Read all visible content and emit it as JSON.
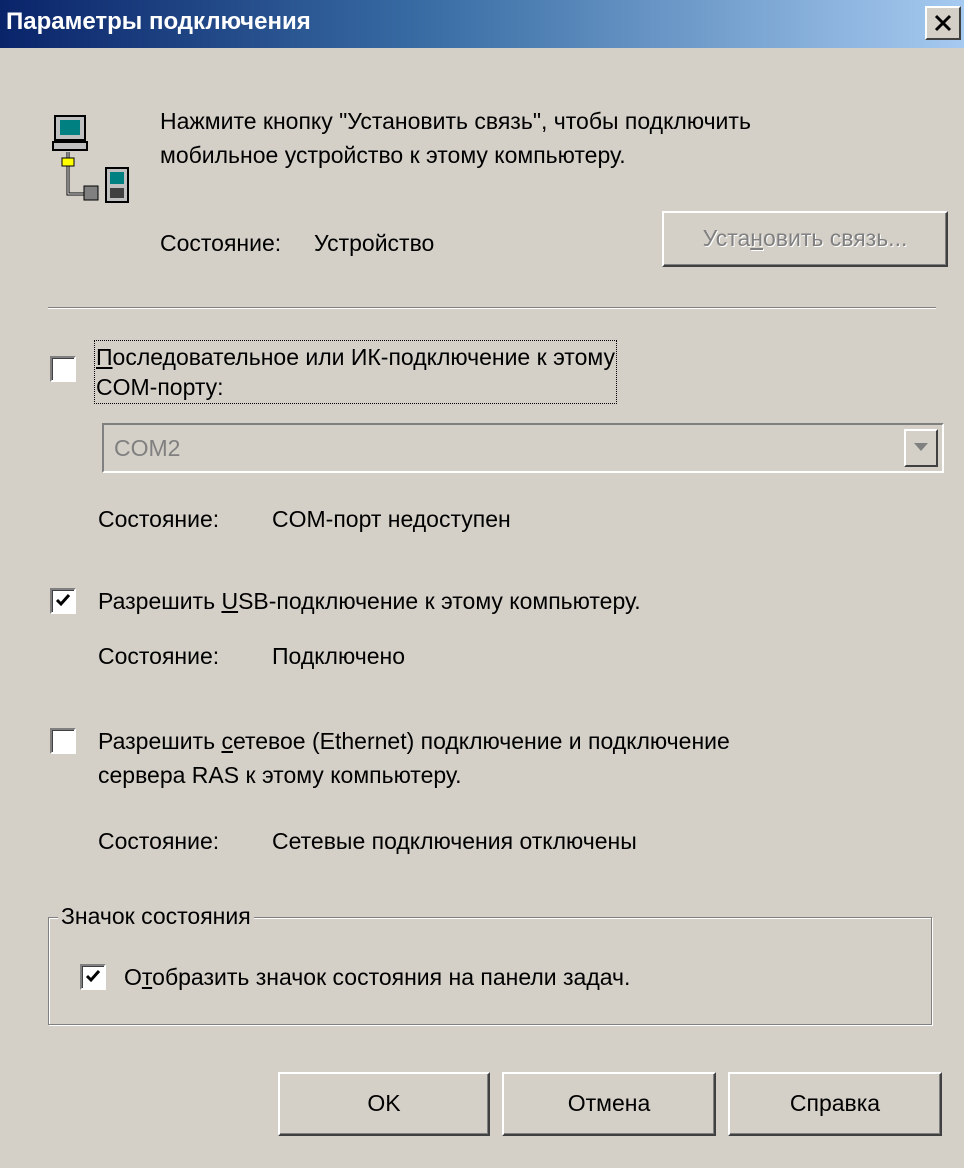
{
  "window": {
    "title": "Параметры подключения"
  },
  "intro": {
    "line1": "Нажмите кнопку \"Установить связь\", чтобы подключить",
    "line2": "мобильное устройство к этому компьютеру."
  },
  "connection": {
    "status_label": "Состояние:",
    "status_value": "Устройство",
    "connect_button": {
      "pre": "Уста",
      "key": "н",
      "post": "овить связь..."
    }
  },
  "serial": {
    "checked": false,
    "label_line1_key": "П",
    "label_line1_rest": "оследовательное или ИК-подключение к этому",
    "label_line2": "COM-порту:",
    "port_value": "COM2",
    "status_label": "Состояние:",
    "status_value": "COM-порт недоступен"
  },
  "usb": {
    "checked": true,
    "label_pre": "Разрешить ",
    "label_key": "U",
    "label_post": "SB-подключение к этому компьютеру.",
    "status_label": "Состояние:",
    "status_value": "Подключено"
  },
  "network": {
    "checked": false,
    "label_pre": "Разрешить ",
    "label_key": "с",
    "label_post": "етевое (Ethernet) подключение и подключение",
    "label_line2": "сервера RAS к этому компьютеру.",
    "status_label": "Состояние:",
    "status_value": "Сетевые подключения отключены"
  },
  "status_icon_group": {
    "title": "Значок состояния",
    "checked": true,
    "label_pre": "О",
    "label_key": "т",
    "label_post": "образить значок состояния на панели задач."
  },
  "buttons": {
    "ok": "OK",
    "cancel": "Отмена",
    "help": "Справка"
  },
  "colors": {
    "face": "#d4d0c8",
    "title_start": "#0a246a",
    "title_end": "#a6caf0",
    "disabled_text": "#808080"
  }
}
